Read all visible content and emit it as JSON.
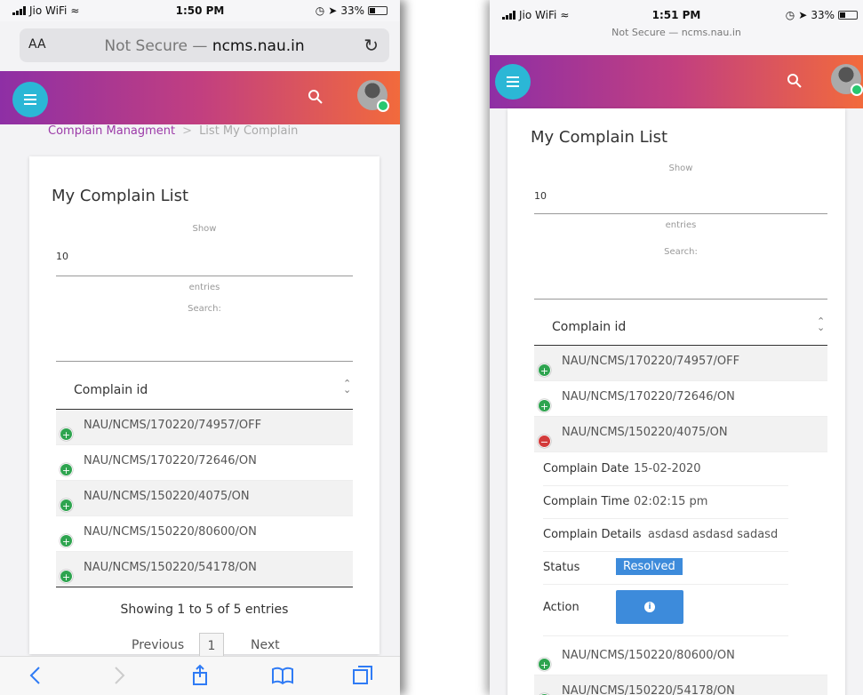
{
  "left": {
    "status": {
      "carrier": "Jio WiFi",
      "time": "1:50 PM",
      "battery": "33%"
    },
    "urlbar": {
      "aa": "AA",
      "prefix": "Not Secure —",
      "domain": "ncms.nau.in"
    },
    "breadcrumb": {
      "section": "Complain Managment",
      "separator": ">",
      "current": "List My Complain"
    },
    "card": {
      "title": "My Complain List",
      "show_label": "Show",
      "show_value": "10",
      "entries_label": "entries",
      "search_label": "Search:",
      "column_header": "Complain id",
      "rows": [
        "NAU/NCMS/170220/74957/OFF",
        "NAU/NCMS/170220/72646/ON",
        "NAU/NCMS/150220/4075/ON",
        "NAU/NCMS/150220/80600/ON",
        "NAU/NCMS/150220/54178/ON"
      ],
      "showing": "Showing 1 to 5 of 5 entries",
      "pager": {
        "previous": "Previous",
        "page": "1",
        "next": "Next"
      }
    }
  },
  "right": {
    "status": {
      "carrier": "Jio WiFi",
      "time": "1:51 PM",
      "battery": "33%",
      "url": "Not Secure — ncms.nau.in"
    },
    "card": {
      "title": "My Complain List",
      "show_label": "Show",
      "show_value": "10",
      "entries_label": "entries",
      "search_label": "Search:",
      "column_header": "Complain id",
      "rows": [
        "NAU/NCMS/170220/74957/OFF",
        "NAU/NCMS/170220/72646/ON",
        "NAU/NCMS/150220/4075/ON"
      ],
      "details": {
        "date_label": "Complain Date",
        "date_value": "15-02-2020",
        "time_label": "Complain Time",
        "time_value": "02:02:15 pm",
        "details_label": "Complain Details",
        "details_value": "asdasd asdasd sadasd",
        "status_label": "Status",
        "status_value": "Resolved",
        "action_label": "Action"
      },
      "rows_after": [
        "NAU/NCMS/150220/80600/ON",
        "NAU/NCMS/150220/54178/ON"
      ]
    }
  },
  "colors": {
    "accent": "#3d8bdb",
    "brand_start": "#8e2fa5",
    "brand_end": "#f26a3c",
    "menu": "#2bb7d6"
  }
}
